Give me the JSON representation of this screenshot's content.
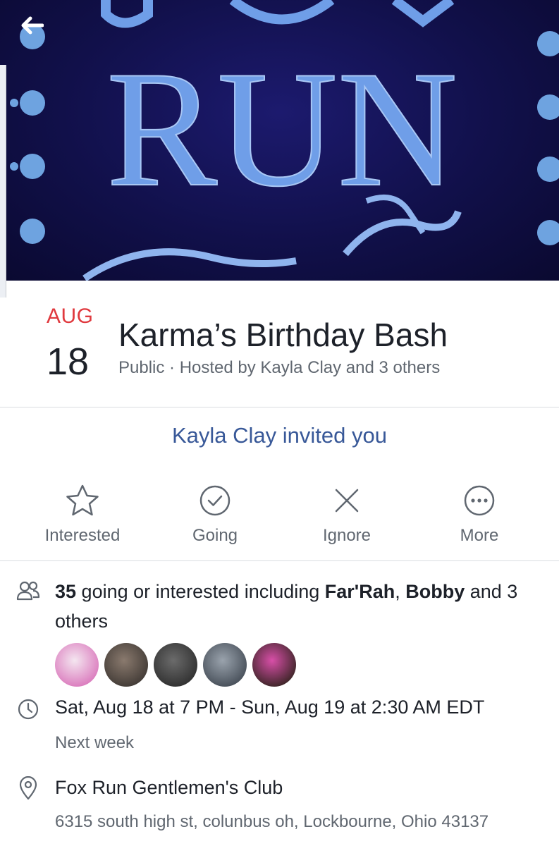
{
  "cover": {
    "sign_text": "RUN",
    "colors": {
      "background": "#11104a",
      "letters": "#6f9ee8",
      "dots": "#6ea3e0"
    }
  },
  "nav": {
    "back_icon": "arrow-left-icon"
  },
  "event": {
    "month": "AUG",
    "day": "18",
    "title": "Karma’s Birthday Bash",
    "subtitle": "Public · Hosted by Kayla Clay and 3 others"
  },
  "invite": {
    "text": "Kayla Clay invited you"
  },
  "actions": [
    {
      "label": "Interested",
      "icon": "star-icon"
    },
    {
      "label": "Going",
      "icon": "check-circle-icon"
    },
    {
      "label": "Ignore",
      "icon": "close-icon"
    },
    {
      "label": "More",
      "icon": "more-icon"
    }
  ],
  "attendance": {
    "count": "35",
    "text_mid": " going or interested including ",
    "name1": "Far'Rah",
    "sep": ", ",
    "name2": "Bobby",
    "text_end": " and 3 others"
  },
  "avatars": [
    {
      "name": "avatar-1",
      "colors": [
        "#f4e6f0",
        "#d86fb8"
      ]
    },
    {
      "name": "avatar-2",
      "colors": [
        "#8a7a6e",
        "#3a3430"
      ]
    },
    {
      "name": "avatar-3",
      "colors": [
        "#6b6b6b",
        "#2a2a2a"
      ]
    },
    {
      "name": "avatar-4",
      "colors": [
        "#9aa3ad",
        "#3e4650"
      ]
    },
    {
      "name": "avatar-5",
      "colors": [
        "#d84fa8",
        "#2b2018"
      ]
    }
  ],
  "datetime": {
    "text": "Sat, Aug 18 at 7 PM - Sun, Aug 19 at 2:30 AM EDT",
    "relative": "Next week"
  },
  "location": {
    "name": "Fox Run Gentlemen's Club",
    "address": "6315 south high st, colunbus oh, Lockbourne, Ohio 43137"
  }
}
